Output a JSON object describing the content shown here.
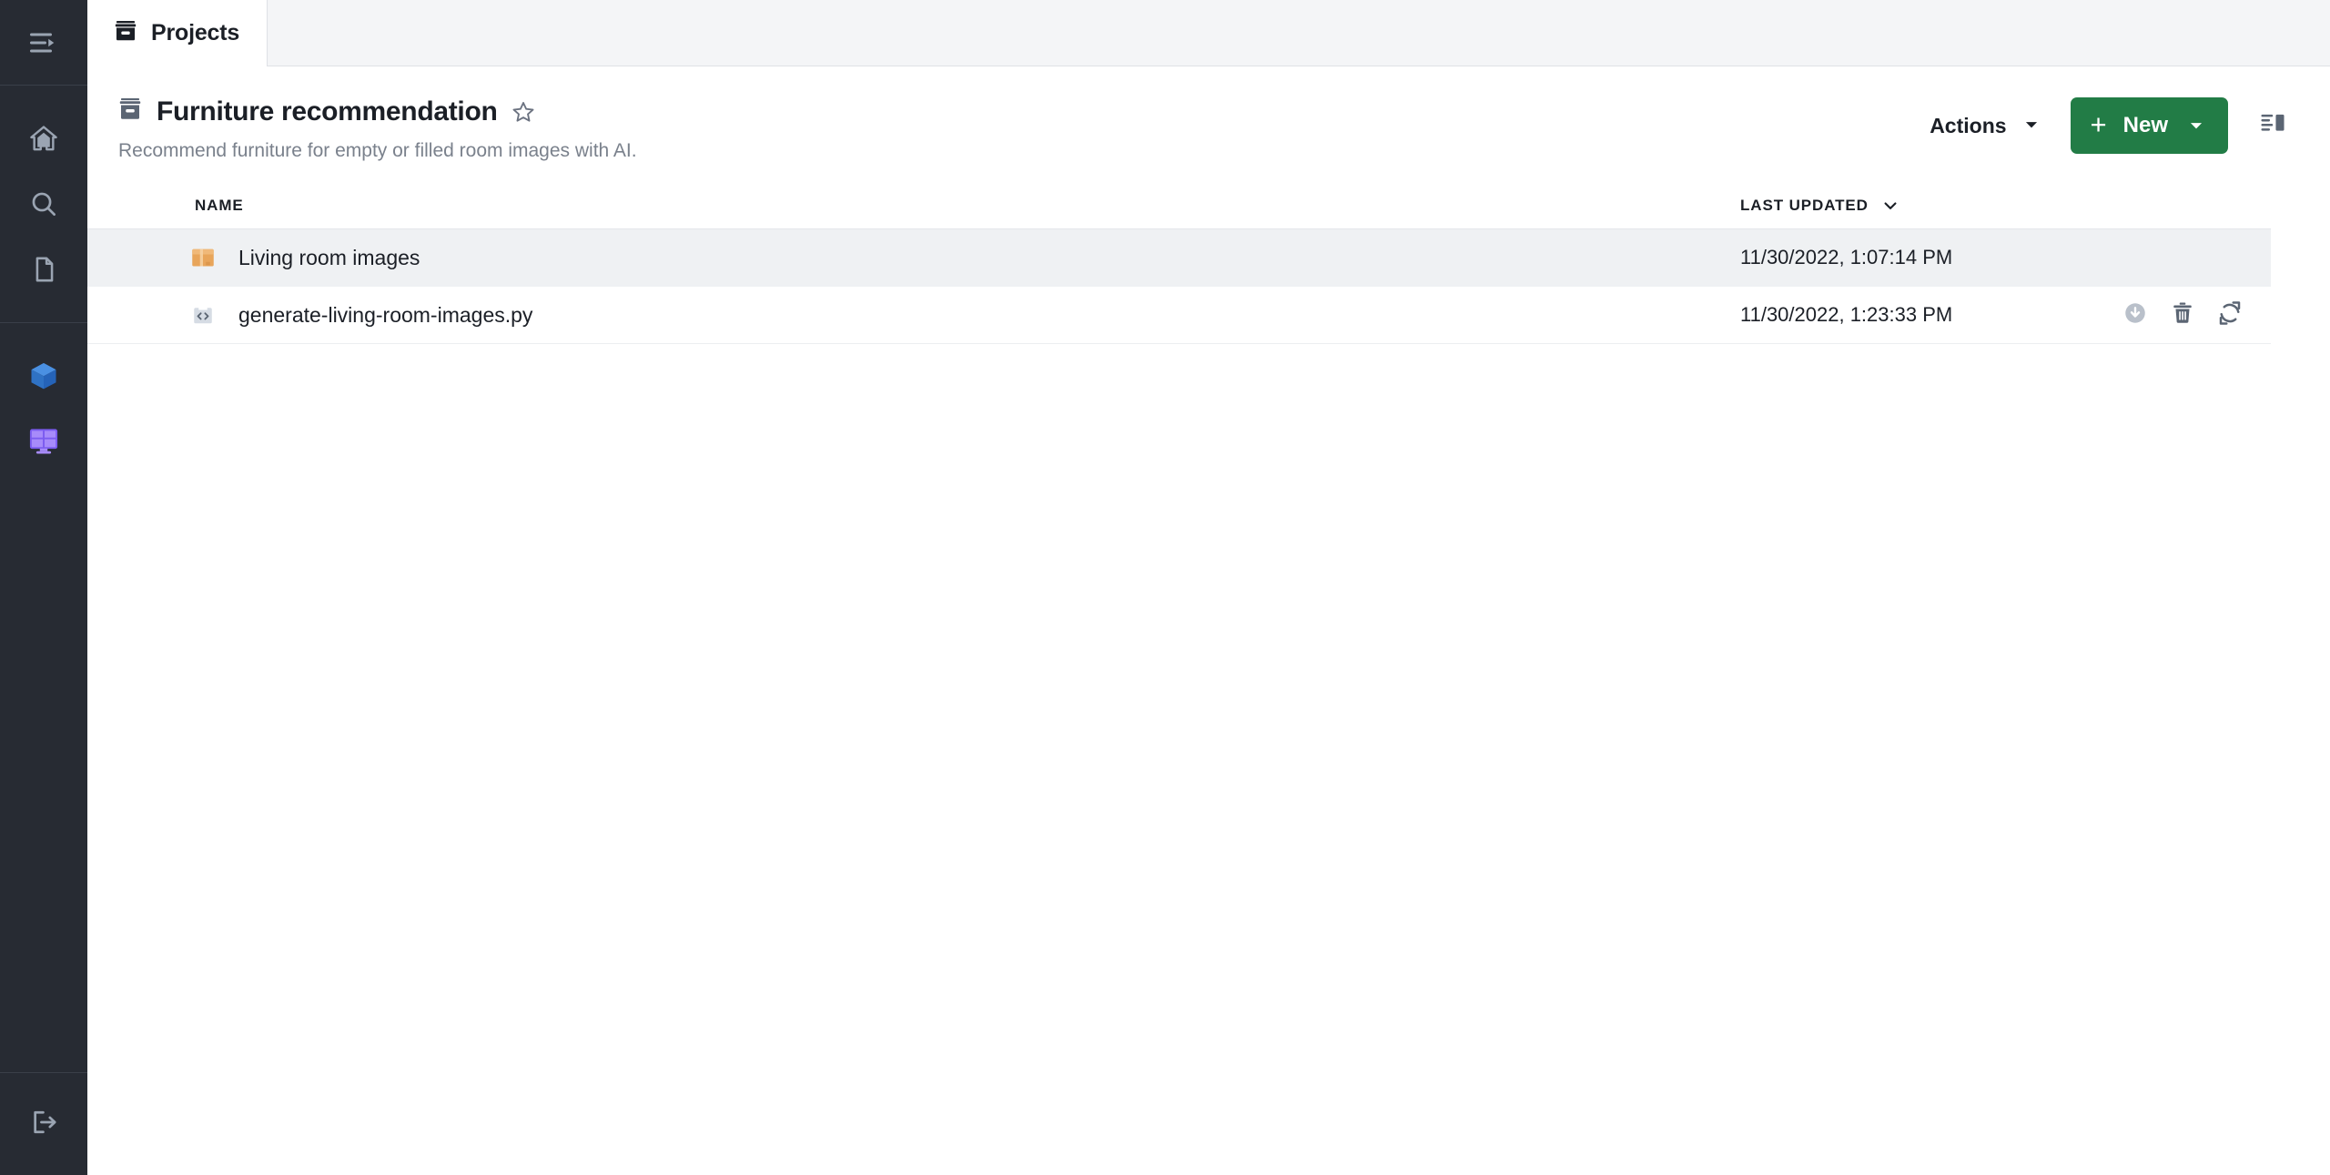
{
  "colors": {
    "rail_bg": "#272b33",
    "rail_icon": "#9aa4b2",
    "cube_blue": "#3b82d6",
    "dashboard_purple": "#a78bfa",
    "new_button_green": "#227c46",
    "row_highlight": "#eff1f3",
    "muted_text": "#7a818c"
  },
  "rail": {
    "toggle": {
      "label": "Expand navigation",
      "icon": "menu-expand-icon"
    },
    "items": [
      {
        "icon": "home-icon",
        "label": "Home"
      },
      {
        "icon": "search-icon",
        "label": "Search"
      },
      {
        "icon": "document-icon",
        "label": "Documents"
      },
      {
        "icon": "cube-icon",
        "label": "Models"
      },
      {
        "icon": "dashboard-icon",
        "label": "Dashboards"
      }
    ],
    "bottom": {
      "icon": "logout-icon",
      "label": "Log out"
    }
  },
  "tabs": [
    {
      "label": "Projects",
      "icon": "archive-box-icon",
      "active": true
    }
  ],
  "header": {
    "icon": "archive-box-icon",
    "title": "Furniture recommendation",
    "favorite_icon": "star-outline-icon",
    "subtitle": "Recommend furniture for empty or filled room images with AI.",
    "actions_label": "Actions",
    "actions_caret_icon": "caret-down-icon",
    "new_label": "New",
    "new_plus_icon": "plus-icon",
    "new_caret_icon": "caret-down-icon",
    "panel_toggle_icon": "side-panel-icon"
  },
  "table": {
    "columns": [
      {
        "key": "name",
        "label": "NAME",
        "sorted": false
      },
      {
        "key": "last_updated",
        "label": "LAST UPDATED",
        "sorted": true,
        "sort_icon": "chevron-down-icon"
      }
    ],
    "rows": [
      {
        "icon": "package-icon",
        "name": "Living room images",
        "last_updated": "11/30/2022, 1:07:14 PM",
        "highlighted": true,
        "actions": []
      },
      {
        "icon": "code-file-icon",
        "name": "generate-living-room-images.py",
        "last_updated": "11/30/2022, 1:23:33 PM",
        "highlighted": false,
        "actions": [
          {
            "icon": "download-icon",
            "label": "Download"
          },
          {
            "icon": "trash-icon",
            "label": "Delete"
          },
          {
            "icon": "sync-icon",
            "label": "Sync"
          }
        ]
      }
    ]
  }
}
